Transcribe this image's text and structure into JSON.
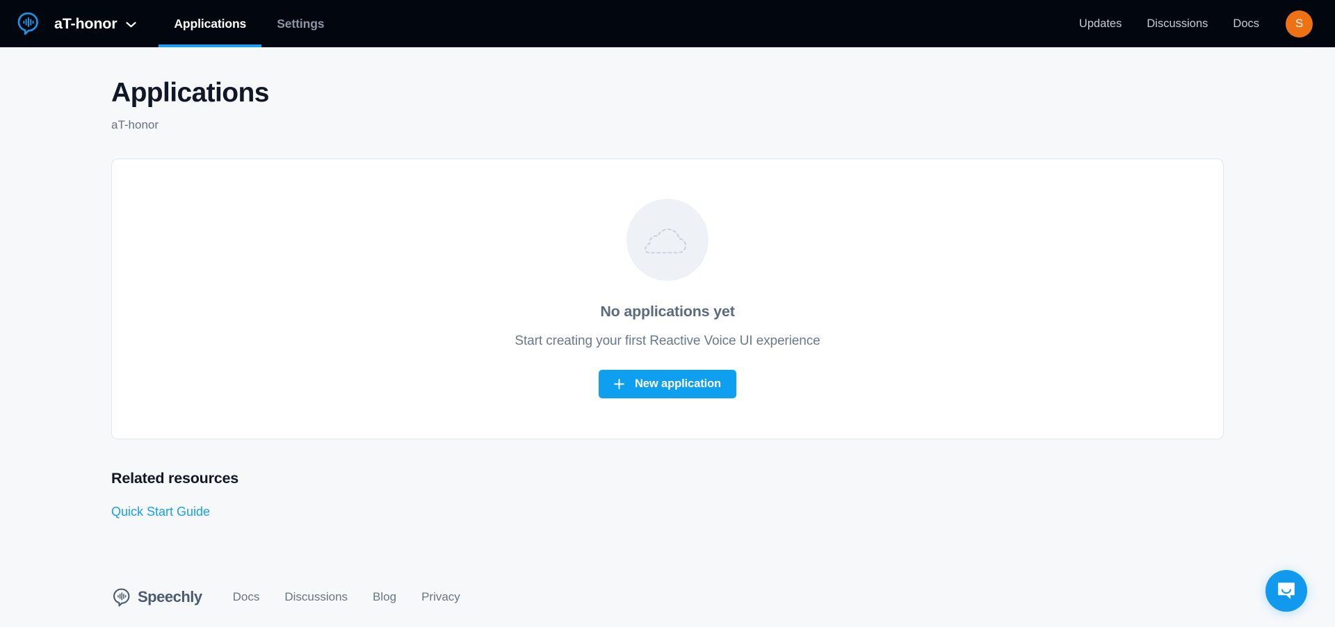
{
  "navbar": {
    "logo_icon": "speechly-logo-icon",
    "org_name": "aT-honor",
    "chevron_icon": "chevron-down-icon",
    "tabs": [
      {
        "label": "Applications",
        "active": true
      },
      {
        "label": "Settings",
        "active": false
      }
    ],
    "links": [
      {
        "label": "Updates"
      },
      {
        "label": "Discussions"
      },
      {
        "label": "Docs"
      }
    ],
    "avatar_initial": "S",
    "avatar_color": "#ee7214",
    "accent_color": "#18a0fb",
    "background_color": "#02060e"
  },
  "page": {
    "title": "Applications",
    "subtitle": "aT-honor"
  },
  "empty_state": {
    "illustration_icon": "cloud-dashed-icon",
    "title": "No applications yet",
    "subtitle": "Start creating your first Reactive Voice UI experience",
    "button_label": "New application",
    "button_icon": "plus-icon",
    "button_color": "#0f9ff0"
  },
  "related_resources": {
    "title": "Related resources",
    "links": [
      {
        "label": "Quick Start Guide"
      }
    ],
    "link_color": "#17a0f5"
  },
  "footer": {
    "logo_icon": "speechly-logo-icon",
    "wordmark": "Speechly",
    "links": [
      {
        "label": "Docs"
      },
      {
        "label": "Discussions"
      },
      {
        "label": "Blog"
      },
      {
        "label": "Privacy"
      }
    ]
  },
  "intercom": {
    "icon": "messenger-bubble-icon",
    "color": "#1199ee"
  }
}
